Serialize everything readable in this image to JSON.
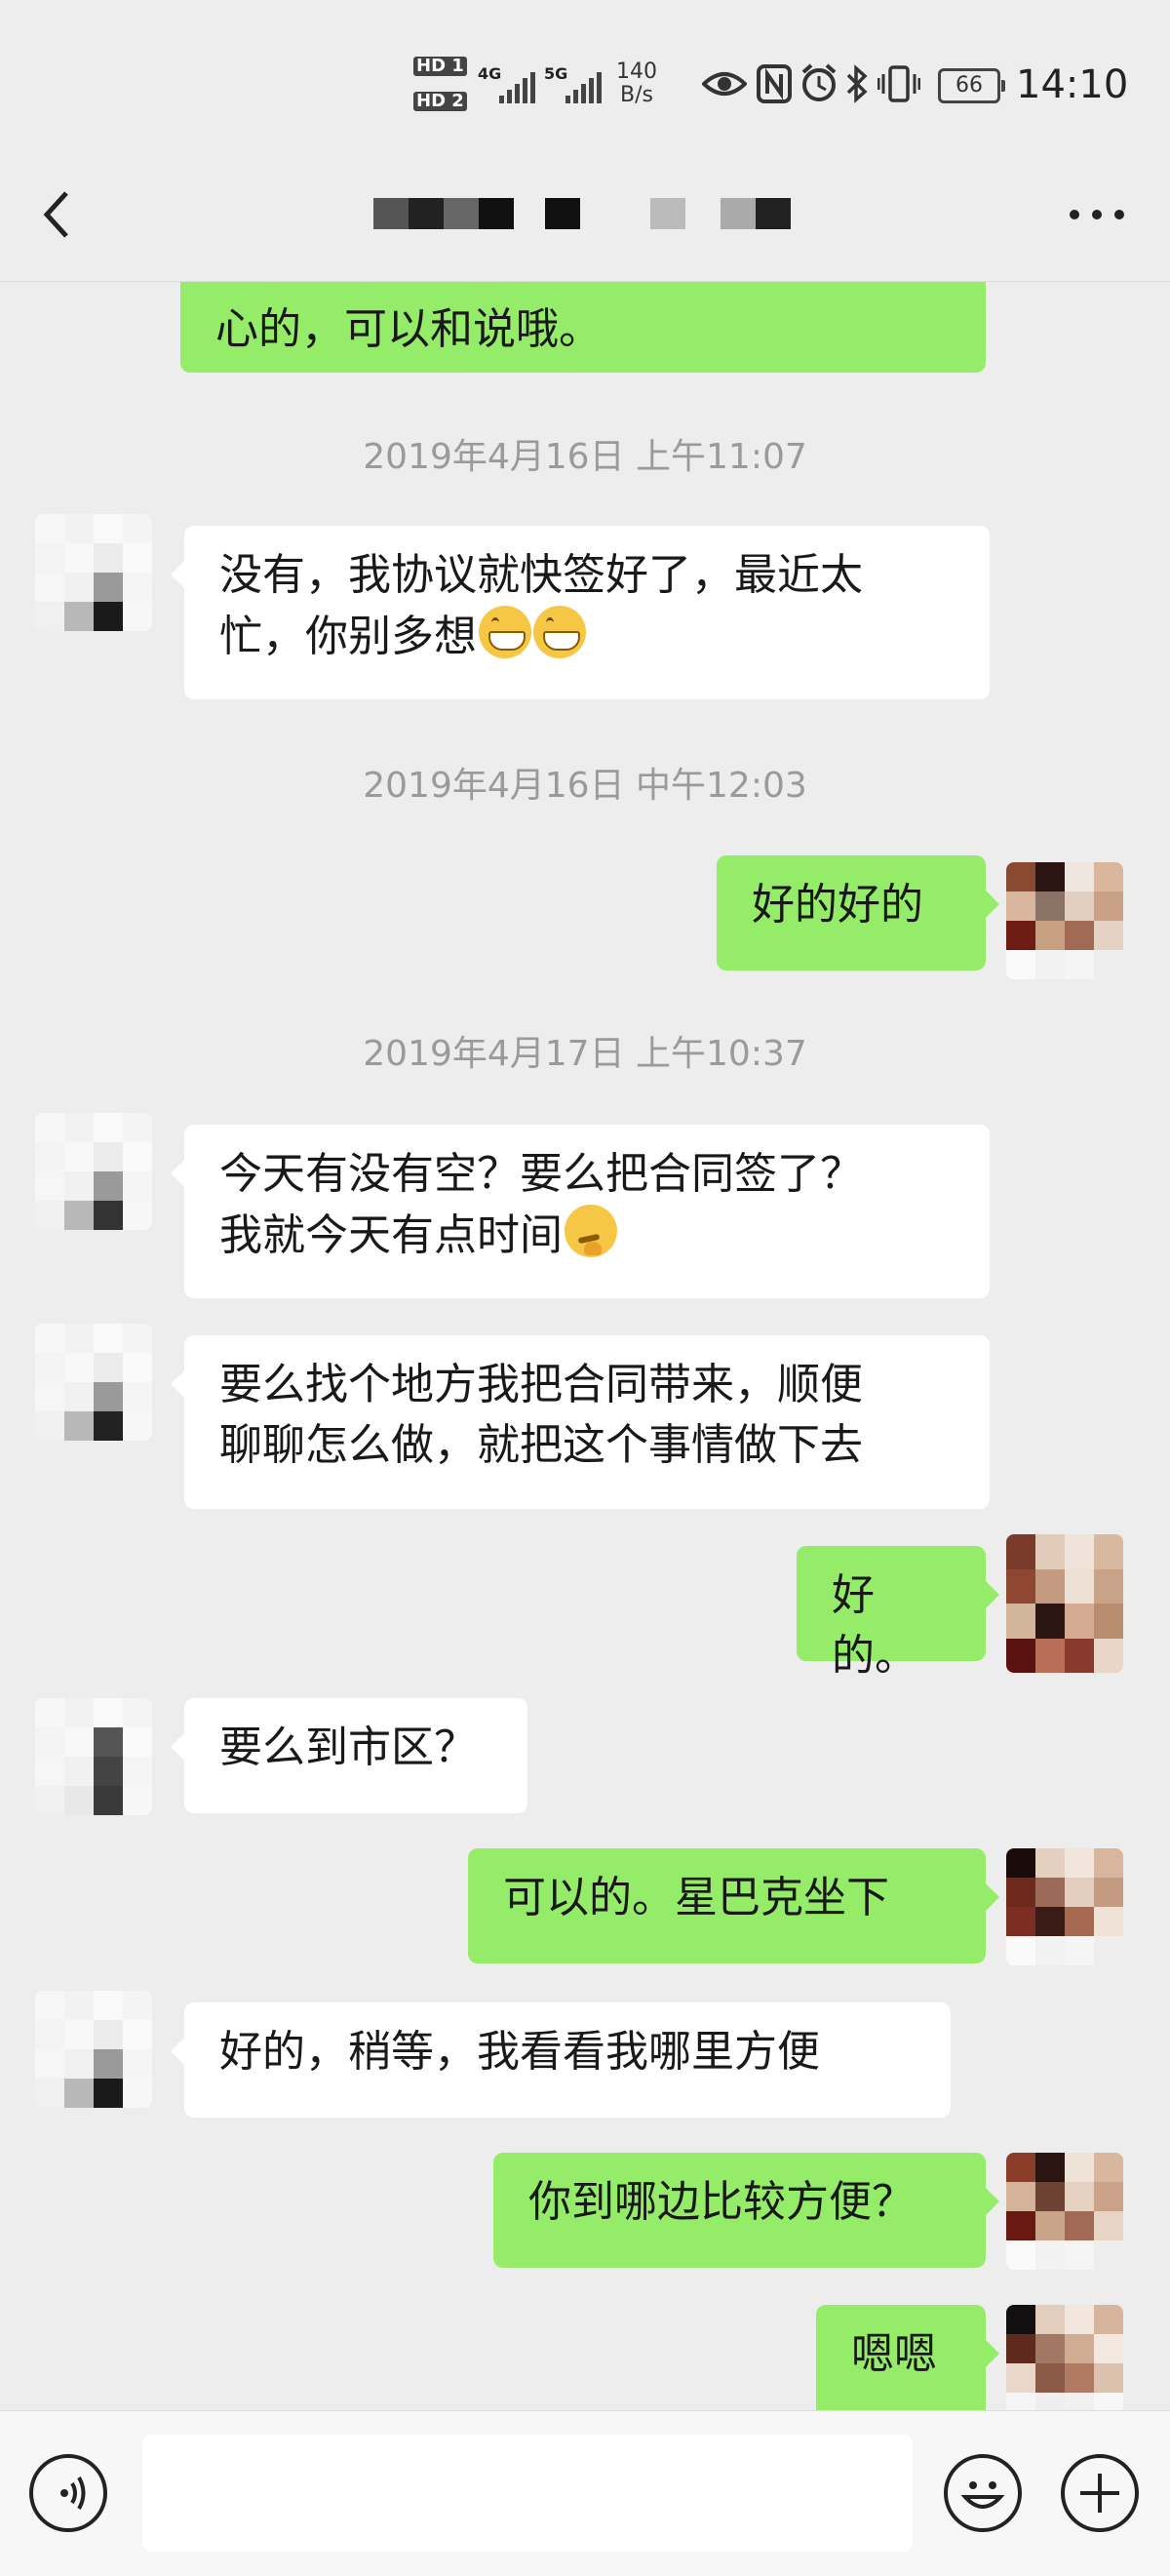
{
  "status_bar": {
    "hd1": "HD 1",
    "hd2": "HD 2",
    "net1": "4G",
    "net2": "5G",
    "speed_value": "140",
    "speed_unit": "B/s",
    "battery": "66",
    "time": "14:10",
    "icons": [
      "eye-icon",
      "nfc-icon",
      "alarm-icon",
      "bluetooth-icon",
      "vibrate-icon"
    ]
  },
  "nav": {
    "back_icon": "chevron-left-icon",
    "title": "",
    "more_icon": "ellipsis-icon"
  },
  "chat": {
    "messages": [
      {
        "type": "text",
        "dir": "out",
        "text": "心的，可以和说哦。"
      },
      {
        "type": "time",
        "text": "2019年4月16日 上午11:07"
      },
      {
        "type": "text",
        "dir": "in",
        "line1": "没有，我协议就快签好了，最近太",
        "line2": "忙，你别多想",
        "emoji": "grin"
      },
      {
        "type": "time",
        "text": "2019年4月16日 中午12:03"
      },
      {
        "type": "text",
        "dir": "out",
        "text": "好的好的"
      },
      {
        "type": "time",
        "text": "2019年4月17日 上午10:37"
      },
      {
        "type": "text",
        "dir": "in",
        "line1": "今天有没有空？要么把合同签了？",
        "line2": "我就今天有点时间",
        "emoji": "think"
      },
      {
        "type": "text",
        "dir": "in",
        "line1": "要么找个地方我把合同带来，顺便",
        "line2": "聊聊怎么做，就把这个事情做下去"
      },
      {
        "type": "text",
        "dir": "out",
        "text": "好的。"
      },
      {
        "type": "text",
        "dir": "in",
        "text": "要么到市区？"
      },
      {
        "type": "text",
        "dir": "out",
        "text": "可以的。星巴克坐下"
      },
      {
        "type": "text",
        "dir": "in",
        "text": "好的，稍等，我看看我哪里方便"
      },
      {
        "type": "text",
        "dir": "out",
        "text": "你到哪边比较方便？"
      },
      {
        "type": "text",
        "dir": "out",
        "text": "嗯嗯"
      }
    ]
  },
  "input_bar": {
    "voice_icon": "voice-icon",
    "input_value": "",
    "emoji_icon": "smiley-icon",
    "plus_icon": "plus-icon"
  },
  "colors": {
    "background": "#ededed",
    "outgoing_bubble": "#95ec69",
    "incoming_bubble": "#ffffff",
    "timestamp_text": "#9a9a9a"
  }
}
